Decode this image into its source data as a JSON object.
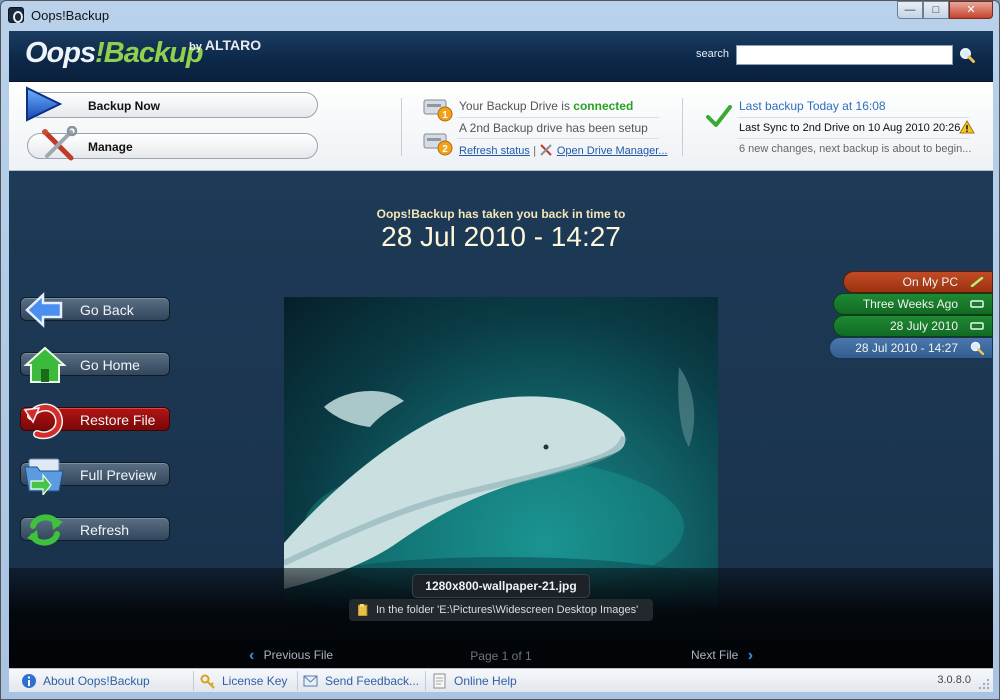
{
  "window": {
    "title": "Oops!Backup"
  },
  "header": {
    "logo_part1": "Oops",
    "logo_bang": "!",
    "logo_part2": "Backup",
    "brand_by": "by",
    "brand_name": "ALTARO",
    "search_label": "search",
    "search_value": ""
  },
  "toolbar": {
    "backup_now": "Backup Now",
    "manage": "Manage"
  },
  "drive_status": {
    "drive_prefix": "Your Backup Drive is",
    "drive_state": "connected",
    "second_drive": "A 2nd Backup drive has been setup",
    "refresh_status": "Refresh status",
    "open_drive_manager": "Open Drive Manager...",
    "link_separator": "|"
  },
  "backup_status": {
    "last_backup": "Last backup Today at 16:08",
    "last_sync": "Last Sync to 2nd Drive on 10 Aug 2010 20:26",
    "changes": "6 new changes, next backup is about to begin..."
  },
  "main": {
    "headline": "Oops!Backup has taken you back in time to",
    "date": "28 Jul 2010 - 14:27",
    "left_buttons": [
      {
        "label": "Go Back"
      },
      {
        "label": "Go Home"
      },
      {
        "label": "Restore File"
      },
      {
        "label": "Full Preview"
      },
      {
        "label": "Refresh"
      }
    ],
    "file_name": "1280x800-wallpaper-21.jpg",
    "folder_text": "In the folder 'E:\\Pictures\\Widescreen Desktop Images'",
    "previous_file": "Previous File",
    "page_indicator": "Page 1 of 1",
    "next_file": "Next File"
  },
  "timeline": [
    {
      "label": "On My PC"
    },
    {
      "label": "Three Weeks Ago"
    },
    {
      "label": "28 July 2010"
    },
    {
      "label": "28 Jul 2010 - 14:27"
    }
  ],
  "statusbar": {
    "about": "About Oops!Backup",
    "license": "License Key",
    "feedback": "Send Feedback...",
    "help": "Online Help",
    "version": "3.0.8.0"
  },
  "colors": {
    "connected": "#27a321",
    "link": "#1f5aa8",
    "on_my_pc": "#b8431f",
    "timeline_green": "#197d2c",
    "timeline_current": "#3f6ba0",
    "restore_red": "#9a0d0d"
  }
}
